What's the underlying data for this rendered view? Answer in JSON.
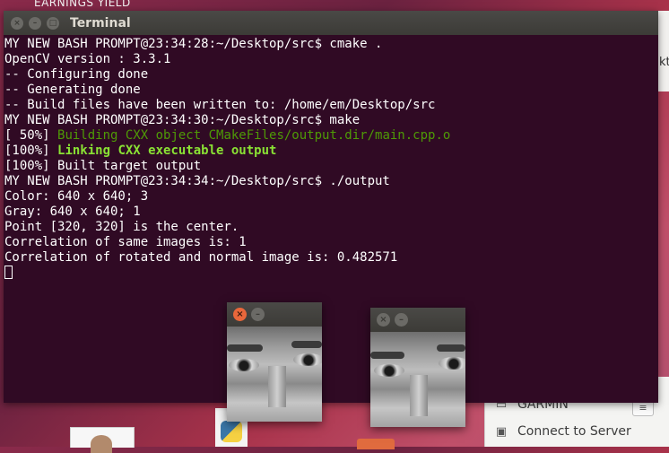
{
  "desktop": {
    "top_label": "EARNINGS YIELD",
    "bg_window_text": "kt"
  },
  "terminal": {
    "title": "Terminal",
    "buttons": {
      "close": "×",
      "minimize": "–",
      "maximize": "□"
    },
    "lines": [
      "MY NEW BASH PROMPT@23:34:28:~/Desktop/src$ cmake .",
      "OpenCV version : 3.3.1",
      "-- Configuring done",
      "-- Generating done",
      "-- Build files have been written to: /home/em/Desktop/src",
      "MY NEW BASH PROMPT@23:34:30:~/Desktop/src$ make",
      {
        "prefix": "[ 50%] ",
        "text": "Building CXX object CMakeFiles/output.dir/main.cpp.o",
        "style": "green"
      },
      {
        "prefix": "[100%] ",
        "text": "Linking CXX executable output",
        "style": "green-bold"
      },
      "[100%] Built target output",
      "MY NEW BASH PROMPT@23:34:34:~/Desktop/src$ ./output",
      "Color: 640 x 640; 3",
      "Gray: 640 x 640; 1",
      "Point [320, 320] is the center.",
      "Correlation of same images is: 1",
      "Correlation of rotated and normal image is: 0.482571"
    ]
  },
  "image_windows": {
    "left": {
      "close": "×",
      "minimize": "–"
    },
    "right": {
      "close": "×",
      "minimize": "–"
    }
  },
  "side_panel": {
    "items": [
      {
        "label": "GARMIN",
        "icon": "drive-icon"
      },
      {
        "label": "Connect to Server",
        "icon": "server-icon"
      }
    ],
    "eject": "≡"
  }
}
